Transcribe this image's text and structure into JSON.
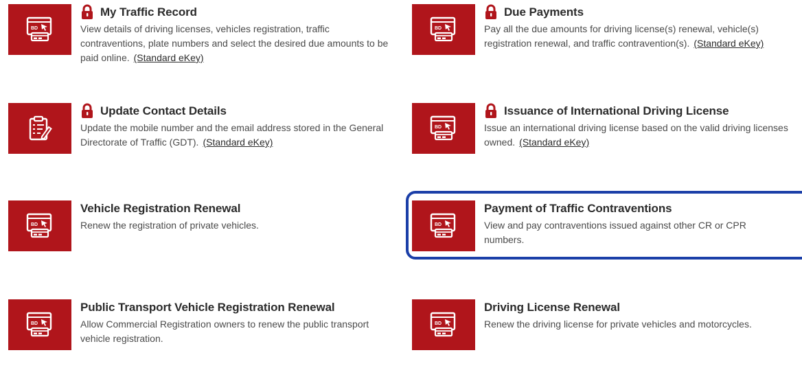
{
  "services": [
    {
      "id": "my-traffic-record",
      "title": "My Traffic Record",
      "locked": true,
      "icon": "payment-card-icon",
      "description": "View details of driving licenses, vehicles registration, traffic contraventions, plate numbers and select the desired due amounts to be paid online.",
      "ekey_label": "(Standard eKey)"
    },
    {
      "id": "due-payments",
      "title": "Due Payments",
      "locked": true,
      "icon": "payment-card-icon",
      "description": "Pay all the due amounts for driving license(s) renewal, vehicle(s) registration renewal, and traffic contravention(s).",
      "ekey_label": "(Standard eKey)"
    },
    {
      "id": "update-contact-details",
      "title": "Update Contact Details",
      "locked": true,
      "icon": "clipboard-edit-icon",
      "description": "Update the mobile number and the email address stored in the General Directorate of Traffic (GDT).",
      "ekey_label": "(Standard eKey)"
    },
    {
      "id": "international-driving-license",
      "title": "Issuance of International Driving License",
      "locked": true,
      "icon": "payment-card-icon",
      "description": "Issue an international driving license based on the valid driving licenses owned.",
      "ekey_label": "(Standard eKey)"
    },
    {
      "id": "vehicle-registration-renewal",
      "title": "Vehicle Registration Renewal",
      "locked": false,
      "icon": "payment-card-icon",
      "description": "Renew the registration of private vehicles.",
      "ekey_label": ""
    },
    {
      "id": "payment-of-traffic-contraventions",
      "title": "Payment of Traffic Contraventions",
      "locked": false,
      "icon": "payment-card-icon",
      "description": "View and pay contraventions issued against other CR or CPR numbers.",
      "ekey_label": ""
    },
    {
      "id": "public-transport-registration-renewal",
      "title": "Public Transport Vehicle Registration Renewal",
      "locked": false,
      "icon": "payment-card-icon",
      "description": "Allow Commercial Registration owners to renew the public transport vehicle registration.",
      "ekey_label": ""
    },
    {
      "id": "driving-license-renewal",
      "title": "Driving License Renewal",
      "locked": false,
      "icon": "payment-card-icon",
      "description": "Renew the driving license for private vehicles and motorcycles.",
      "ekey_label": ""
    }
  ],
  "highlighted_service": "payment-of-traffic-contraventions",
  "colors": {
    "tile_red": "#b0151b",
    "highlight_blue": "#1b3fa8",
    "title_text": "#2b2b2b",
    "desc_text": "#4a4a4a"
  }
}
